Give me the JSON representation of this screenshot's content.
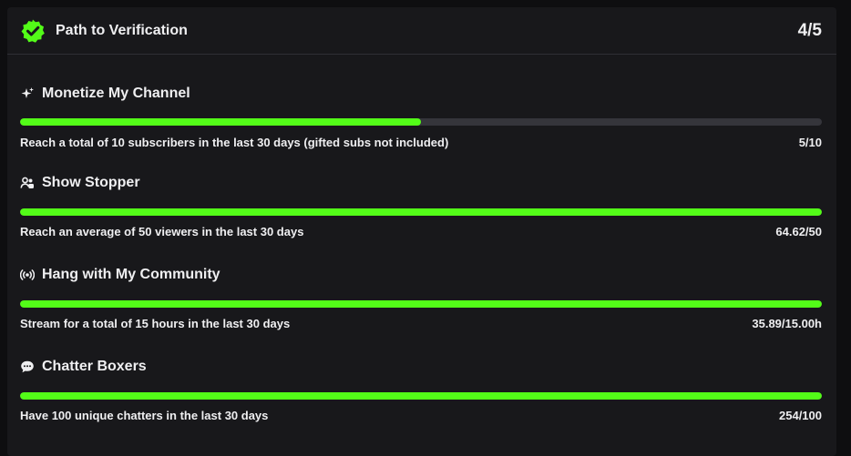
{
  "header": {
    "title": "Path to Verification",
    "progress": "4/5",
    "badge_icon": "verified-check-icon",
    "accent_color": "#53fc18"
  },
  "goals": [
    {
      "icon": "sparkle-icon",
      "name": "Monetize My Channel",
      "description": "Reach a total of 10 subscribers in the last 30 days (gifted subs not included)",
      "value": "5/10",
      "fill_fraction": 0.5
    },
    {
      "icon": "users-icon",
      "name": "Show Stopper",
      "description": "Reach an average of 50 viewers in the last 30 days",
      "value": "64.62/50",
      "fill_fraction": 1.0
    },
    {
      "icon": "broadcast-icon",
      "name": "Hang with My Community",
      "description": "Stream for a total of 15 hours in the last 30 days",
      "value": "35.89/15.00h",
      "fill_fraction": 1.0
    },
    {
      "icon": "chat-bubble-icon",
      "name": "Chatter Boxers",
      "description": "Have 100 unique chatters in the last 30 days",
      "value": "254/100",
      "fill_fraction": 1.0
    }
  ]
}
